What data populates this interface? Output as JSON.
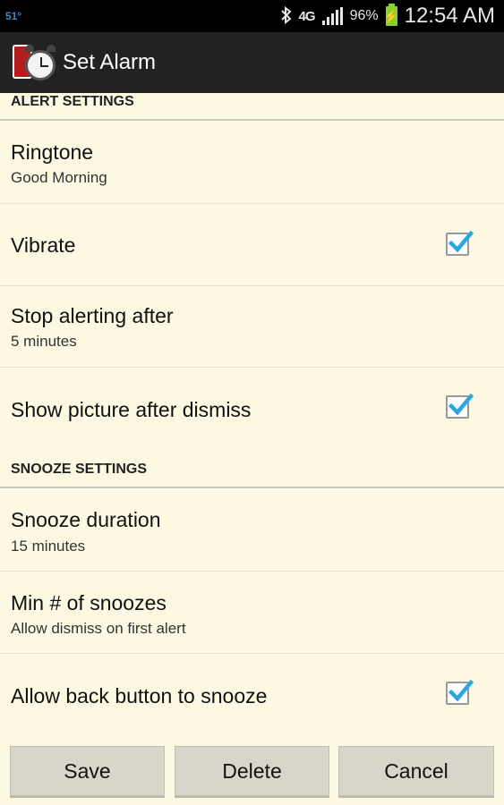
{
  "status_bar": {
    "left_text": "51°",
    "battery_pct": "96%",
    "time": "12:54 AM",
    "network": "4G",
    "icons": [
      "bluetooth-icon",
      "4g-icon",
      "signal-icon",
      "battery-charging-icon"
    ]
  },
  "action_bar": {
    "title": "Set Alarm",
    "icon": "alarm-clock-app-icon"
  },
  "sections": {
    "alert_header": "ALERT SETTINGS",
    "snooze_header": "SNOOZE SETTINGS"
  },
  "prefs": {
    "ringtone": {
      "title": "Ringtone",
      "summary": "Good Morning"
    },
    "vibrate": {
      "title": "Vibrate",
      "checked": true
    },
    "stop_alerting": {
      "title": "Stop alerting after",
      "summary": "5 minutes"
    },
    "show_picture": {
      "title": "Show picture after dismiss",
      "checked": true
    },
    "snooze_duration": {
      "title": "Snooze duration",
      "summary": "15 minutes"
    },
    "min_snoozes": {
      "title": "Min # of snoozes",
      "summary": "Allow dismiss on first alert"
    },
    "back_button": {
      "title": "Allow back button to snooze",
      "checked": true
    }
  },
  "buttons": {
    "save": "Save",
    "delete": "Delete",
    "cancel": "Cancel"
  },
  "colors": {
    "background": "#fdf8e2",
    "check_accent": "#2aa6e0",
    "action_bar": "#222222"
  }
}
